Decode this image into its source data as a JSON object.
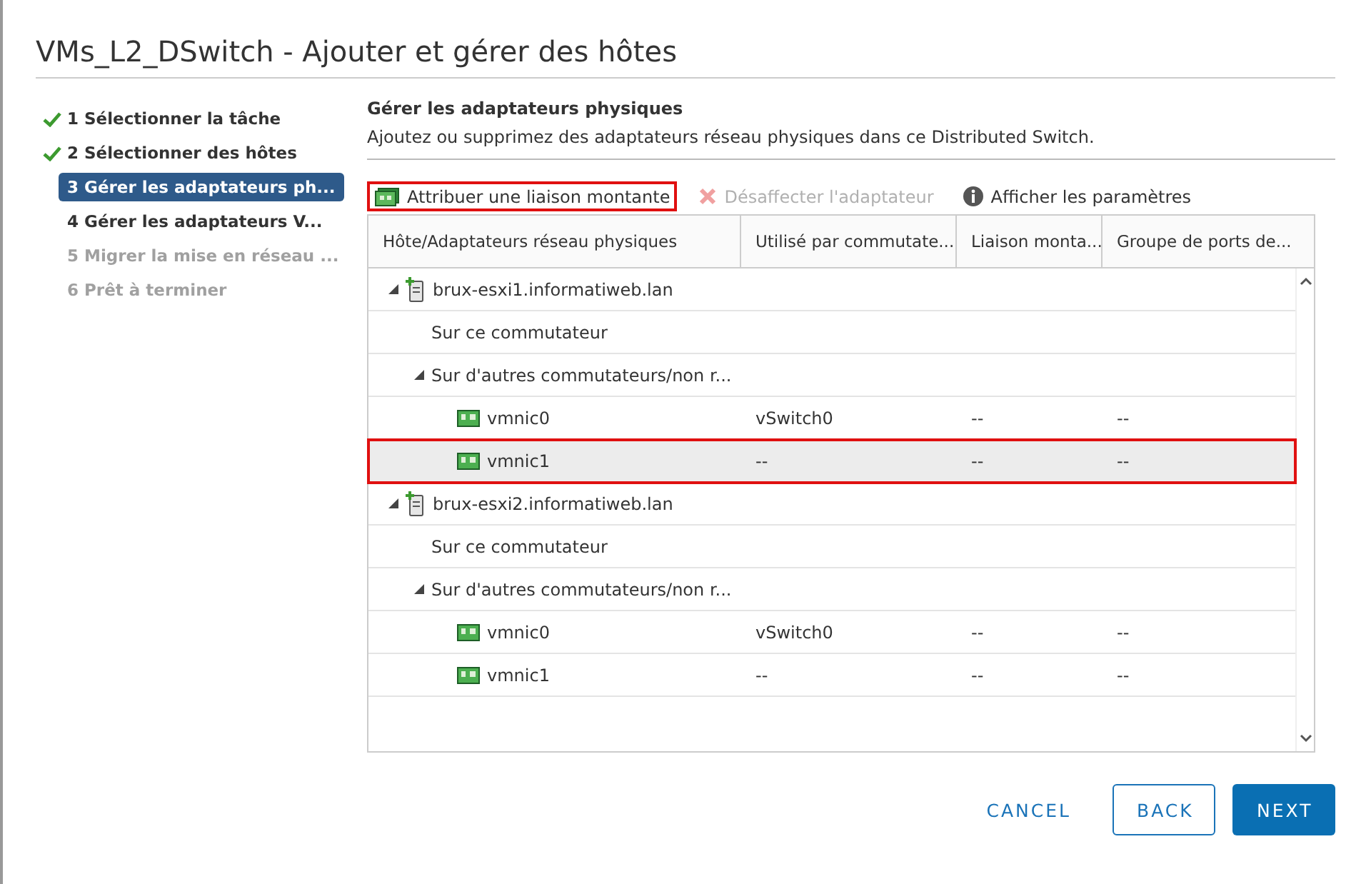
{
  "window": {
    "title": "VMs_L2_DSwitch - Ajouter et gérer des hôtes"
  },
  "steps": [
    {
      "label": "1 Sélectionner la tâche",
      "completed": true,
      "selected": false,
      "disabled": false
    },
    {
      "label": "2 Sélectionner des hôtes",
      "completed": true,
      "selected": false,
      "disabled": false
    },
    {
      "label": "3 Gérer les adaptateurs ph...",
      "completed": false,
      "selected": true,
      "disabled": false
    },
    {
      "label": "4 Gérer les adaptateurs V...",
      "completed": false,
      "selected": false,
      "disabled": false
    },
    {
      "label": "5 Migrer la mise en réseau ...",
      "completed": false,
      "selected": false,
      "disabled": true
    },
    {
      "label": "6 Prêt à terminer",
      "completed": false,
      "selected": false,
      "disabled": true
    }
  ],
  "section": {
    "title": "Gérer les adaptateurs physiques",
    "description": "Ajoutez ou supprimez des adaptateurs réseau physiques dans ce Distributed Switch."
  },
  "toolbar": [
    {
      "label": "Attribuer une liaison montante",
      "kind": "assign",
      "disabled": false,
      "highlighted": true
    },
    {
      "label": "Désaffecter l'adaptateur",
      "kind": "unassign",
      "disabled": true,
      "highlighted": false
    },
    {
      "label": "Afficher les paramètres",
      "kind": "info",
      "disabled": false,
      "highlighted": false
    }
  ],
  "table": {
    "columns": [
      "Hôte/Adaptateurs réseau physiques",
      "Utilisé par commutate...",
      "Liaison monta...",
      "Groupe de ports de..."
    ],
    "rows": [
      {
        "label": "brux-esxi1.informatiweb.lan",
        "kind": "host",
        "expanded": true,
        "children": [
          {
            "label": "Sur ce commutateur"
          },
          {
            "label": "Sur d'autres commutateurs/non r...",
            "expanded": true,
            "children": [
              {
                "label": "vmnic0",
                "kind": "nic",
                "selected": false,
                "highlighted": false,
                "values": [
                  "vSwitch0",
                  "--",
                  "--"
                ]
              },
              {
                "label": "vmnic1",
                "kind": "nic",
                "selected": true,
                "highlighted": true,
                "values": [
                  "--",
                  "--",
                  "--"
                ]
              }
            ]
          }
        ]
      },
      {
        "label": "brux-esxi2.informatiweb.lan",
        "kind": "host",
        "expanded": true,
        "children": [
          {
            "label": "Sur ce commutateur"
          },
          {
            "label": "Sur d'autres commutateurs/non r...",
            "expanded": true,
            "children": [
              {
                "label": "vmnic0",
                "kind": "nic",
                "selected": false,
                "highlighted": false,
                "values": [
                  "vSwitch0",
                  "--",
                  "--"
                ]
              },
              {
                "label": "vmnic1",
                "kind": "nic",
                "selected": false,
                "highlighted": false,
                "values": [
                  "--",
                  "--",
                  "--"
                ]
              }
            ]
          }
        ]
      }
    ]
  },
  "buttons": [
    {
      "label": "CANCEL",
      "kind": "link"
    },
    {
      "label": "BACK",
      "kind": "outline"
    },
    {
      "label": "NEXT",
      "kind": "primary"
    }
  ]
}
